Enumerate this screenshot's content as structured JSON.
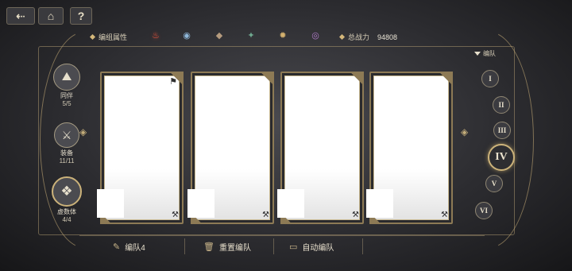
{
  "topbar": {
    "back_label": "⇠",
    "home_label": "⌂",
    "help_label": "?"
  },
  "attributes": {
    "label": "编组属性",
    "icons": [
      {
        "name": "fire-icon",
        "glyph": "♨",
        "color": "#e0503a",
        "selected": true
      },
      {
        "name": "water-icon",
        "glyph": "◉",
        "color": "#8fb7d9"
      },
      {
        "name": "earth-icon",
        "glyph": "◆",
        "color": "#b59b7e"
      },
      {
        "name": "wind-icon",
        "glyph": "✦",
        "color": "#6fa98f"
      },
      {
        "name": "light-icon",
        "glyph": "✹",
        "color": "#d3b06e"
      },
      {
        "name": "dark-icon",
        "glyph": "◎",
        "color": "#b07bc9"
      }
    ]
  },
  "power": {
    "label": "总战力",
    "value": "94808"
  },
  "sidebar": {
    "items": [
      {
        "label": "同伴",
        "count": "5/5",
        "glyph": "⛰"
      },
      {
        "label": "装备",
        "count": "11/11",
        "glyph": "⚔"
      },
      {
        "label": "虚数体",
        "count": "4/4",
        "glyph": "❖"
      }
    ]
  },
  "cards": [
    {
      "has_flag": true,
      "flag": "⚑",
      "wrench": "⚒"
    },
    {
      "has_flag": false,
      "wrench": "⚒"
    },
    {
      "has_flag": false,
      "wrench": "⚒"
    },
    {
      "has_flag": false,
      "wrench": "⚒"
    }
  ],
  "teams": {
    "header": "编队",
    "numerals": [
      "I",
      "II",
      "III",
      "IV",
      "V",
      "VI"
    ],
    "active_index": 3
  },
  "bottom": {
    "team_name": "编队4",
    "reset_label": "重置编队",
    "auto_label": "自动编队",
    "team_icon": "✎",
    "reset_icon": "🗑",
    "auto_icon": "▭"
  }
}
